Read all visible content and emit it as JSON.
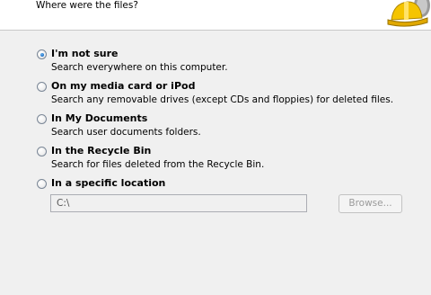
{
  "header": {
    "subtitle": "Where were the files?"
  },
  "options": [
    {
      "title": "I'm not sure",
      "description": "Search everywhere on this computer.",
      "selected": true
    },
    {
      "title": "On my media card or iPod",
      "description": "Search any removable drives (except CDs and floppies) for deleted files.",
      "selected": false
    },
    {
      "title": "In My Documents",
      "description": "Search user documents folders.",
      "selected": false
    },
    {
      "title": "In the Recycle Bin",
      "description": "Search for files deleted from the Recycle Bin.",
      "selected": false
    },
    {
      "title": "In a specific location",
      "description": "",
      "selected": false
    }
  ],
  "location": {
    "path_value": "C:\\",
    "browse_label": "Browse..."
  },
  "icons": {
    "logo": "hardhat-wizard-icon"
  }
}
